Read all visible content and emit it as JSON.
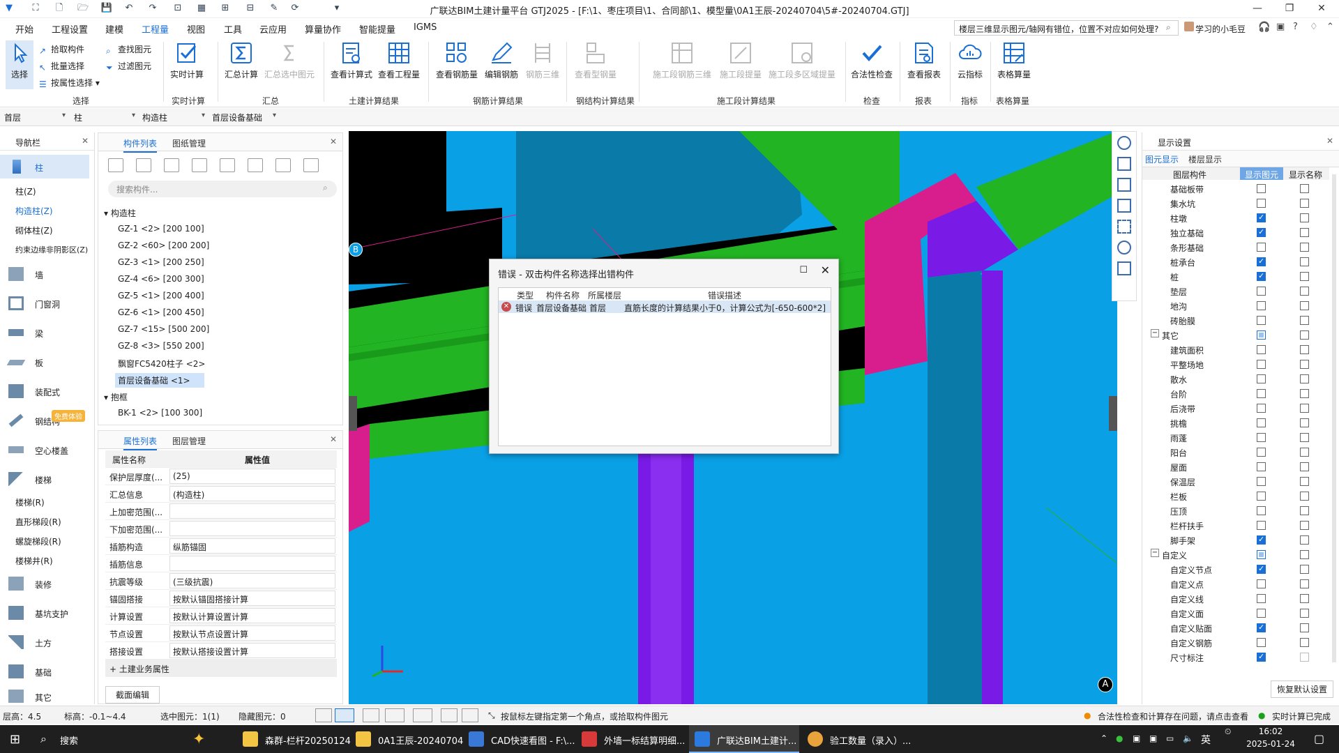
{
  "window": {
    "title": "广联达BIM土建计量平台 GTJ2025 - [F:\\1、枣庄项目\\1、合同部\\1、模型量\\0A1王辰-20240704\\5#-20240704.GTJ]",
    "min": "—",
    "max": "❐",
    "close": "✕"
  },
  "menu": {
    "items": [
      "开始",
      "工程设置",
      "建模",
      "工程量",
      "视图",
      "工具",
      "云应用",
      "算量协作",
      "智能提量",
      "IGMS"
    ],
    "help_search": "楼层三维显示图元/轴网有错位，位置不对应如何处理?",
    "user": "学习的小毛豆"
  },
  "ribbon": {
    "select": {
      "label": "选择",
      "pick": "拾取构件",
      "batch": "批量选择",
      "by_attr": "按属性选择",
      "find": "查找图元",
      "filter": "过滤图元",
      "group": "选择"
    },
    "realtime": {
      "label": "实时计算",
      "group": "实时计算"
    },
    "summary": {
      "calc": "汇总计算",
      "selected": "汇总选中图元",
      "group": "汇总"
    },
    "civil": {
      "formula": "查看计算式",
      "quantity": "查看工程量",
      "group": "土建计算结果"
    },
    "rebar": {
      "view": "查看钢筋量",
      "edit": "编辑钢筋",
      "three_d": "钢筋三维",
      "group": "钢筋计算结果"
    },
    "steel": {
      "view": "查看型钢量",
      "group": "钢结构计算结果"
    },
    "construction": {
      "rebar3d": "施工段钢筋三维",
      "extract": "施工段提量",
      "multi": "施工段多区域提量",
      "group": "施工段计算结果"
    },
    "check": {
      "label": "合法性检查",
      "group": "检查"
    },
    "report": {
      "label": "查看报表",
      "group": "报表"
    },
    "index": {
      "label": "云指标",
      "group": "指标"
    },
    "table": {
      "label": "表格算量",
      "group": "表格算量"
    }
  },
  "filters": [
    "首层",
    "柱",
    "构造柱",
    "首层设备基础"
  ],
  "nav": {
    "title": "导航栏",
    "items": [
      {
        "label": "柱",
        "active": true
      },
      {
        "label": "墙"
      },
      {
        "label": "门窗洞"
      },
      {
        "label": "梁"
      },
      {
        "label": "板"
      },
      {
        "label": "装配式"
      },
      {
        "label": "钢结构"
      },
      {
        "label": "空心楼盖"
      },
      {
        "label": "楼梯"
      },
      {
        "label": "装修"
      },
      {
        "label": "基坑支护"
      },
      {
        "label": "土方"
      },
      {
        "label": "基础"
      },
      {
        "label": "其它"
      }
    ],
    "col_sub": [
      "柱(Z)",
      "构造柱(Z)",
      "砌体柱(Z)",
      "约束边缘非阴影区(Z)"
    ],
    "stair_sub": [
      "楼梯(R)",
      "直形梯段(R)",
      "螺旋梯段(R)",
      "楼梯井(R)"
    ],
    "trial_badge": "免费体验"
  },
  "components": {
    "tabs": [
      "构件列表",
      "图纸管理"
    ],
    "search_placeholder": "搜索构件...",
    "group1": "构造柱",
    "items": [
      "GZ-1 <2> [200 100]",
      "GZ-2 <60> [200 200]",
      "GZ-3 <1> [200 250]",
      "GZ-4 <6> [200 300]",
      "GZ-5 <1> [200 400]",
      "GZ-6 <1> [200 450]",
      "GZ-7 <15> [500 200]",
      "GZ-8 <3> [550 200]",
      "飘窗FC5420柱子 <2>",
      "首层设备基础 <1>"
    ],
    "group2": "抱框",
    "items2": [
      "BK-1 <2> [100 300]"
    ]
  },
  "properties": {
    "tabs": [
      "属性列表",
      "图层管理"
    ],
    "col_name": "属性名称",
    "col_value": "属性值",
    "rows": [
      {
        "name": "保护层厚度(...",
        "value": "(25)"
      },
      {
        "name": "汇总信息",
        "value": "(构造柱)"
      },
      {
        "name": "上加密范围(...",
        "value": ""
      },
      {
        "name": "下加密范围(...",
        "value": ""
      },
      {
        "name": "插筋构造",
        "value": "纵筋锚固"
      },
      {
        "name": "插筋信息",
        "value": ""
      },
      {
        "name": "抗震等级",
        "value": "(三级抗震)"
      },
      {
        "name": "锚固搭接",
        "value": "按默认锚固搭接计算"
      },
      {
        "name": "计算设置",
        "value": "按默认计算设置计算"
      },
      {
        "name": "节点设置",
        "value": "按默认节点设置计算"
      },
      {
        "name": "搭接设置",
        "value": "按默认搭接设置计算"
      }
    ],
    "section": "土建业务属性",
    "edit_button": "截面编辑"
  },
  "viewport": {
    "axis_b": "B",
    "axis_a": "A"
  },
  "dialog": {
    "title": "错误 - 双击构件名称选择出错构件",
    "headers": [
      "类型",
      "构件名称",
      "所属楼层",
      "错误描述"
    ],
    "row": {
      "type": "错误",
      "name": "首层设备基础",
      "floor": "首层",
      "desc": "直筋长度的计算结果小于0，计算公式为[-650-600*2]"
    }
  },
  "display": {
    "title": "显示设置",
    "tabs": [
      "图元显示",
      "楼层显示"
    ],
    "headers": [
      "图层构件",
      "显示图元",
      "显示名称"
    ],
    "rows": [
      {
        "name": "基础板带",
        "show": "off",
        "label": "off"
      },
      {
        "name": "集水坑",
        "show": "off",
        "label": "off"
      },
      {
        "name": "柱墩",
        "show": "on",
        "label": "off"
      },
      {
        "name": "独立基础",
        "show": "on",
        "label": "off"
      },
      {
        "name": "条形基础",
        "show": "off",
        "label": "off"
      },
      {
        "name": "桩承台",
        "show": "on",
        "label": "off"
      },
      {
        "name": "桩",
        "show": "on",
        "label": "off"
      },
      {
        "name": "垫层",
        "show": "off",
        "label": "off"
      },
      {
        "name": "地沟",
        "show": "off",
        "label": "off"
      },
      {
        "name": "砖胎膜",
        "show": "off",
        "label": "off"
      },
      {
        "name": "其它",
        "show": "part",
        "label": "off",
        "group": true
      },
      {
        "name": "建筑面积",
        "show": "off",
        "label": "off"
      },
      {
        "name": "平整场地",
        "show": "off",
        "label": "off"
      },
      {
        "name": "散水",
        "show": "off",
        "label": "off"
      },
      {
        "name": "台阶",
        "show": "off",
        "label": "off"
      },
      {
        "name": "后浇带",
        "show": "off",
        "label": "off"
      },
      {
        "name": "挑檐",
        "show": "off",
        "label": "off"
      },
      {
        "name": "雨蓬",
        "show": "off",
        "label": "off"
      },
      {
        "name": "阳台",
        "show": "off",
        "label": "off"
      },
      {
        "name": "屋面",
        "show": "off",
        "label": "off"
      },
      {
        "name": "保温层",
        "show": "off",
        "label": "off"
      },
      {
        "name": "栏板",
        "show": "off",
        "label": "off"
      },
      {
        "name": "压顶",
        "show": "off",
        "label": "off"
      },
      {
        "name": "栏杆扶手",
        "show": "off",
        "label": "off"
      },
      {
        "name": "脚手架",
        "show": "on",
        "label": "off"
      },
      {
        "name": "自定义",
        "show": "part",
        "label": "off",
        "group": true
      },
      {
        "name": "自定义节点",
        "show": "on",
        "label": "off"
      },
      {
        "name": "自定义点",
        "show": "off",
        "label": "off"
      },
      {
        "name": "自定义线",
        "show": "off",
        "label": "off"
      },
      {
        "name": "自定义面",
        "show": "off",
        "label": "off"
      },
      {
        "name": "自定义贴面",
        "show": "on",
        "label": "off"
      },
      {
        "name": "自定义钢筋",
        "show": "off",
        "label": "off"
      },
      {
        "name": "尺寸标注",
        "show": "on",
        "label": "dim"
      }
    ],
    "reset": "恢复默认设置"
  },
  "status": {
    "floor_height": "层高：4.5",
    "elevation": "标高：-0.1~4.4",
    "selected": "选中图元：1(1)",
    "hidden": "隐藏图元：0",
    "hint": "按鼠标左键指定第一个角点，或拾取构件图元",
    "warning": "合法性检查和计算存在问题，请点击查看",
    "realtime": "实时计算已完成"
  },
  "taskbar": {
    "search": "搜索",
    "tasks": [
      "森群-栏杆20250124",
      "0A1王辰-20240704",
      "CAD快速看图 - F:\\...",
      "外墙一标结算明细...",
      "广联达BIM土建计...",
      "验工数量（录入）..."
    ],
    "ime": "英",
    "time": "16:02",
    "date": "2025-01-24"
  },
  "colors": {
    "accent": "#1a6fd6",
    "cyan": "#0aa0e6",
    "green": "#22b422",
    "magenta": "#d81e8c",
    "purple": "#7a1ae6",
    "teal": "#0a7aa8"
  }
}
